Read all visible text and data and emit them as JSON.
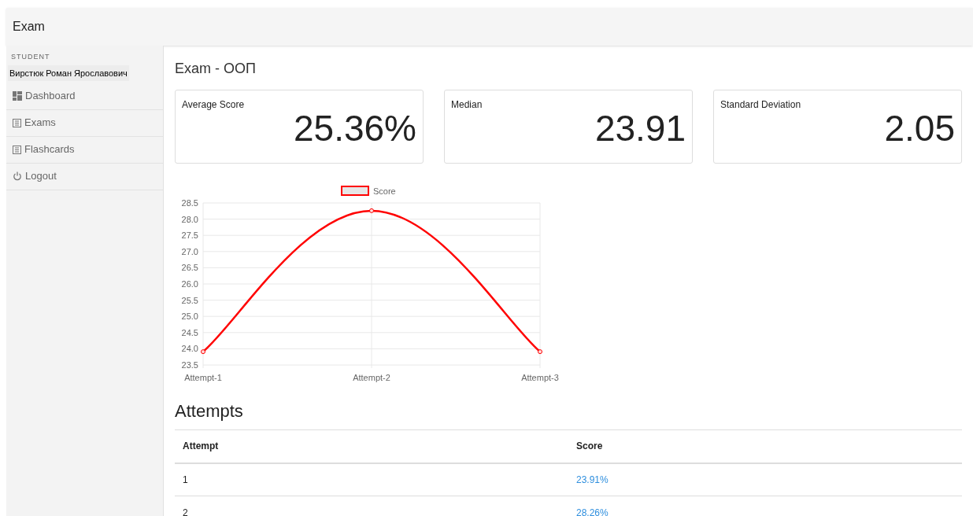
{
  "app_bar": {
    "title": "Exam"
  },
  "sidebar": {
    "role": "STUDENT",
    "user": "Вирстюк Роман Ярославович",
    "items": [
      {
        "label": "Dashboard",
        "kind": "dashboard"
      },
      {
        "label": "Exams",
        "kind": "list"
      },
      {
        "label": "Flashcards",
        "kind": "list"
      },
      {
        "label": "Logout",
        "kind": "power"
      }
    ]
  },
  "page_title": "Exam - ООП",
  "stats": [
    {
      "label": "Average Score",
      "value": "25.36%"
    },
    {
      "label": "Median",
      "value": "23.91"
    },
    {
      "label": "Standard Deviation",
      "value": "2.05"
    }
  ],
  "chart_data": {
    "type": "line",
    "categories": [
      "Attempt-1",
      "Attempt-2",
      "Attempt-3"
    ],
    "grid": true,
    "series": [
      {
        "name": "Score",
        "color": "#ff0000",
        "marker": "circle",
        "values": [
          23.91,
          28.26,
          23.91
        ]
      }
    ],
    "ylim": [
      23.5,
      28.5
    ],
    "yticks": [
      {
        "value": 23.5,
        "label": "23.5"
      },
      {
        "value": 24,
        "label": "24.0"
      },
      {
        "value": 24.5,
        "label": "24.5"
      },
      {
        "value": 25,
        "label": "25.0"
      },
      {
        "value": 25.5,
        "label": "25.5"
      },
      {
        "value": 26,
        "label": "26.0"
      },
      {
        "value": 26.5,
        "label": "26.5"
      },
      {
        "value": 27,
        "label": "27.0"
      },
      {
        "value": 27.5,
        "label": "27.5"
      },
      {
        "value": 28,
        "label": "28.0"
      },
      {
        "value": 28.5,
        "label": "28.5"
      }
    ]
  },
  "attempts": {
    "title": "Attempts",
    "columns": [
      "Attempt",
      "Score"
    ],
    "rows": [
      [
        "1",
        "23.91%"
      ],
      [
        "2",
        "28.26%"
      ]
    ]
  }
}
